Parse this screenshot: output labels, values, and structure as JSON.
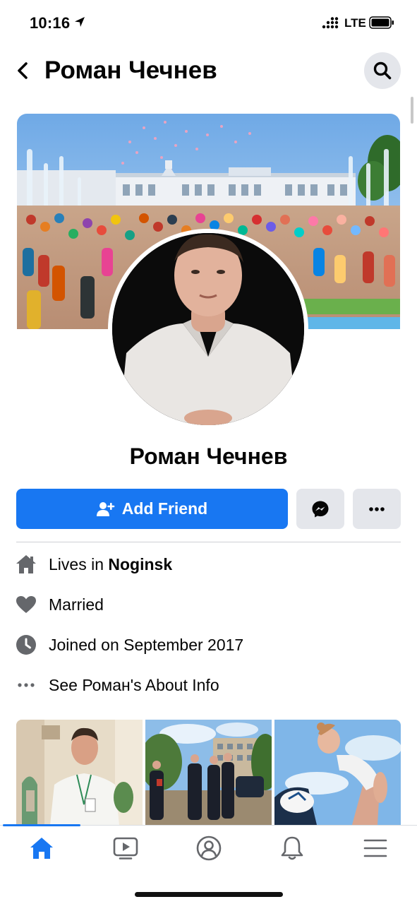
{
  "status_bar": {
    "time": "10:16",
    "network": "LTE"
  },
  "header": {
    "title": "Роман Чечнев"
  },
  "profile": {
    "name": "Роман Чечнев"
  },
  "actions": {
    "add_friend_label": "Add Friend"
  },
  "info": {
    "lives_prefix": "Lives in ",
    "lives_city": "Noginsk",
    "relationship": "Married",
    "joined": "Joined on September 2017",
    "about": "See Роман's About Info"
  },
  "colors": {
    "brand_blue": "#1877f2",
    "button_gray": "#e4e6eb",
    "icon_gray": "#65676b"
  },
  "icons": {
    "back": "chevron-left-icon",
    "search": "search-icon",
    "add_friend": "person-add-icon",
    "messenger": "messenger-icon",
    "more": "more-horizontal-icon",
    "home_info": "house-icon",
    "relationship": "heart-icon",
    "joined": "clock-icon",
    "about": "ellipsis-icon",
    "tabs": [
      "home-icon",
      "video-icon",
      "profile-icon",
      "bell-icon",
      "menu-icon"
    ]
  },
  "tabbar": {
    "active_tab": "home"
  }
}
